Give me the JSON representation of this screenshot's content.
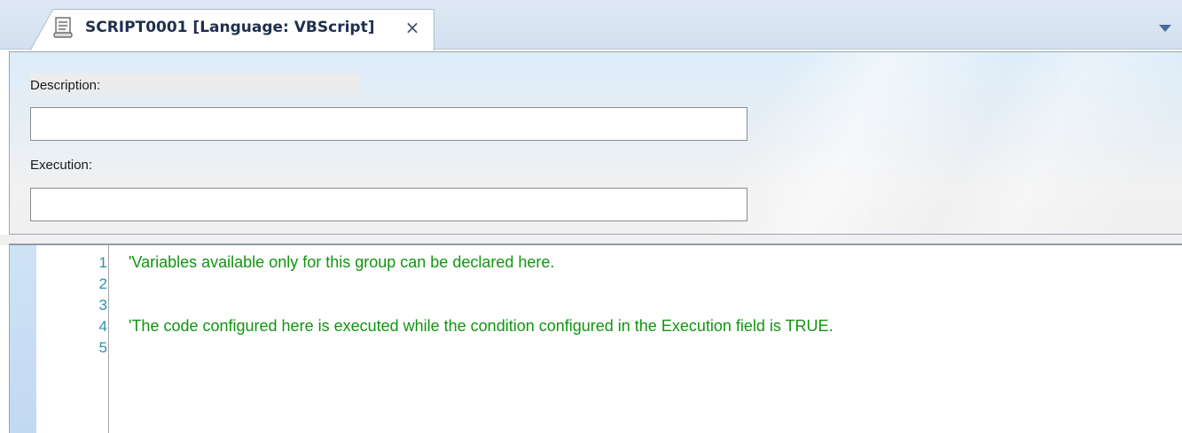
{
  "tab": {
    "title": "SCRIPT0001 [Language: VBScript]",
    "close_glyph": "×",
    "icon": "script-icon",
    "menu_icon": "dropdown-arrow-icon"
  },
  "form": {
    "description_label": "Description:",
    "description_value": "",
    "execution_label": "Execution:",
    "execution_value": ""
  },
  "editor": {
    "line_numbers": [
      "1",
      "2",
      "3",
      "4",
      "5"
    ],
    "lines": [
      "'Variables available only for this group can be declared here.",
      "",
      "",
      "'The code configured here is executed while the condition configured in the Execution field is TRUE.",
      ""
    ],
    "comment_color": "#119411",
    "line_number_color": "#2b91af"
  }
}
